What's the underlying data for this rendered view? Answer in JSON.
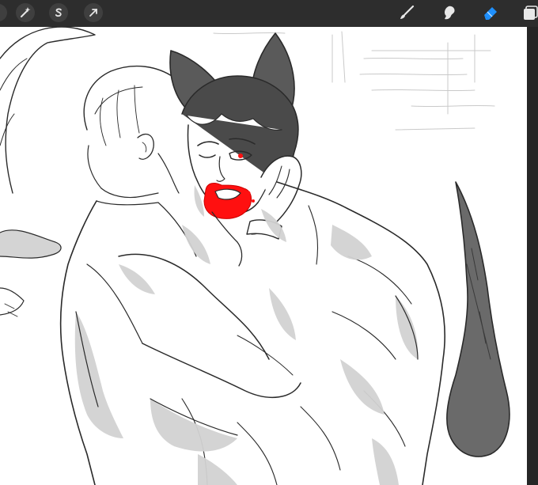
{
  "app": {
    "name": "drawing canvas"
  },
  "toolbar": {
    "left_tools": [
      {
        "name": "adjustments-wand-icon"
      },
      {
        "name": "selection-s-icon"
      },
      {
        "name": "transform-arrow-icon"
      }
    ],
    "right_tools": [
      {
        "name": "brush-icon"
      },
      {
        "name": "smudge-icon"
      },
      {
        "name": "eraser-icon",
        "active": true
      },
      {
        "name": "layers-icon"
      }
    ],
    "active_color": "#1e90ff"
  },
  "canvas": {
    "background": "#ffffff",
    "ink_color": "#2a2a2a",
    "shade_color": "#cfcfcf",
    "accent_color": "#ff1010"
  }
}
